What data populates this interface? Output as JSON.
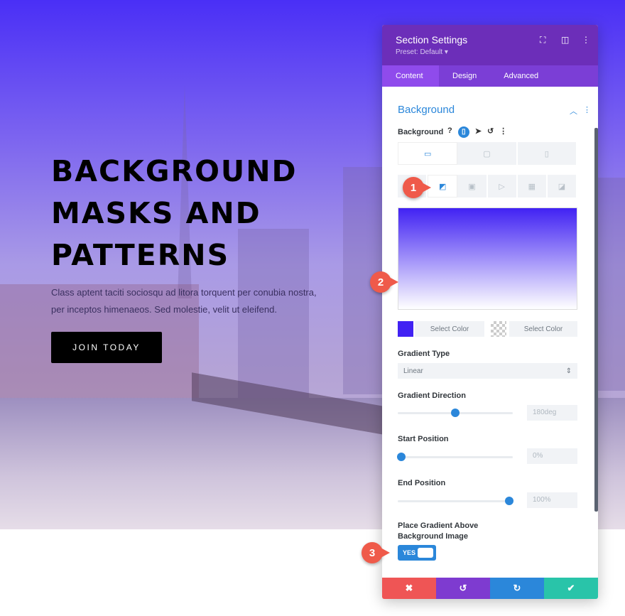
{
  "hero": {
    "heading_lines": [
      "BACKGROUND",
      "MASKS AND",
      "PATTERNS"
    ],
    "body": "Class aptent taciti sociosqu ad litora torquent per conubia nostra, per inceptos himenaeos. Sed molestie, velit ut eleifend.",
    "cta": "JOIN TODAY"
  },
  "panel": {
    "title": "Section Settings",
    "preset": "Preset: Default ▾",
    "tabs": [
      "Content",
      "Design",
      "Advanced"
    ],
    "active_tab": "Content",
    "section_title": "Background",
    "field_label": "Background",
    "gradient": {
      "start_color": "#4122f3",
      "end_color": "#ffffff",
      "select_color_1": "Select Color",
      "select_color_2": "Select Color"
    },
    "gradient_type_label": "Gradient Type",
    "gradient_type": "Linear",
    "direction_label": "Gradient Direction",
    "direction": "180deg",
    "direction_value": 180,
    "start_label": "Start Position",
    "start": "0%",
    "start_value": 0,
    "end_label": "End Position",
    "end": "100%",
    "end_value": 100,
    "place_above_label": "Place Gradient Above Background Image",
    "toggle": "YES"
  },
  "badges": [
    "1",
    "2",
    "3"
  ],
  "colors": {
    "header": "#6c2eb9",
    "accent": "#2b87da",
    "cancel": "#ef5555",
    "undo": "#7e3bd0",
    "redo": "#2b87da",
    "save": "#29c4a9"
  }
}
